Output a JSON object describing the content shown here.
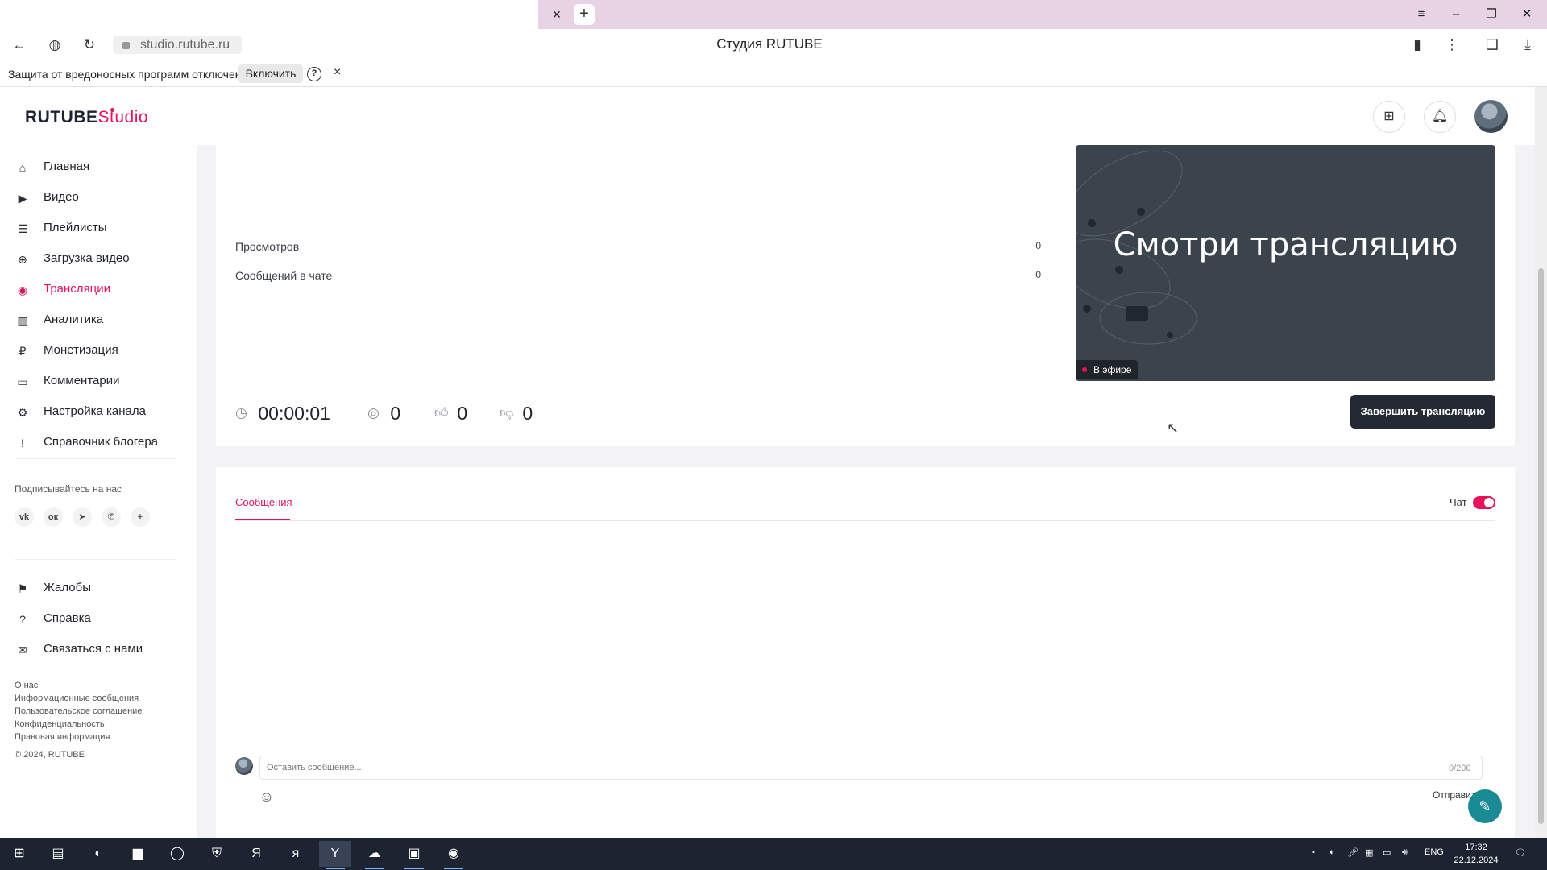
{
  "browser": {
    "tab_close": "×",
    "new_tab": "+",
    "url": "studio.rutube.ru",
    "title": "Студия RUTUBE",
    "infobar": {
      "message": "Защита от вредоносных программ отключена",
      "enable_label": "Включить",
      "help": "?",
      "close": "×"
    }
  },
  "header": {
    "logo_main": "RUTUBE",
    "logo_studio": "Studio"
  },
  "sidebar": {
    "items": [
      {
        "label": "Главная",
        "icon": "home-icon",
        "glyph": "⌂"
      },
      {
        "label": "Видео",
        "icon": "video-icon",
        "glyph": "▶"
      },
      {
        "label": "Плейлисты",
        "icon": "playlist-icon",
        "glyph": "☰"
      },
      {
        "label": "Загрузка видео",
        "icon": "upload-icon",
        "glyph": "⊕"
      },
      {
        "label": "Трансляции",
        "icon": "broadcast-icon",
        "glyph": "◉"
      },
      {
        "label": "Аналитика",
        "icon": "analytics-icon",
        "glyph": "▥"
      },
      {
        "label": "Монетизация",
        "icon": "monetization-icon",
        "glyph": "₽"
      },
      {
        "label": "Комментарии",
        "icon": "comments-icon",
        "glyph": "▭"
      },
      {
        "label": "Настройка канала",
        "icon": "settings-icon",
        "glyph": "⚙"
      },
      {
        "label": "Справочник блогера",
        "icon": "guide-icon",
        "glyph": "!"
      }
    ],
    "subscribe_label": "Подписывайтесь на нас",
    "socials": [
      {
        "label": "vk",
        "icon": "vk-icon"
      },
      {
        "label": "ок",
        "icon": "ok-icon"
      },
      {
        "label": "➤",
        "icon": "telegram-icon"
      },
      {
        "label": "✆",
        "icon": "viber-icon"
      },
      {
        "label": "+",
        "icon": "more-social-icon"
      }
    ],
    "bottom_items": [
      {
        "label": "Жалобы",
        "icon": "flag-icon",
        "glyph": "⚑"
      },
      {
        "label": "Справка",
        "icon": "help-icon",
        "glyph": "?"
      },
      {
        "label": "Связаться с нами",
        "icon": "mail-icon",
        "glyph": "✉"
      }
    ],
    "footer_links": [
      "О нас",
      "Информационные сообщения",
      "Пользовательское соглашение",
      "Конфиденциальность",
      "Правовая информация"
    ],
    "copyright": "© 2024, RUTUBE"
  },
  "stream": {
    "stats": [
      {
        "label": "Просмотров",
        "value": "0"
      },
      {
        "label": "Сообщений в чате",
        "value": "0"
      }
    ],
    "preview_title": "Смотри трансляцию",
    "live_badge": "В эфире",
    "duration": "00:00:01",
    "viewers": "0",
    "likes": "0",
    "dislikes": "0",
    "end_button": "Завершить трансляцию"
  },
  "chat": {
    "tab_label": "Сообщения",
    "chat_label": "Чат",
    "chat_enabled": true,
    "input_placeholder": "Оставить сообщение...",
    "char_count": "0/200",
    "send_label": "Отправить"
  },
  "taskbar": {
    "lang": "ENG",
    "time": "17:32",
    "date": "22.12.2024"
  },
  "colors": {
    "accent": "#e5145a",
    "dark": "#232a33",
    "preview_bg": "#3b444d"
  }
}
